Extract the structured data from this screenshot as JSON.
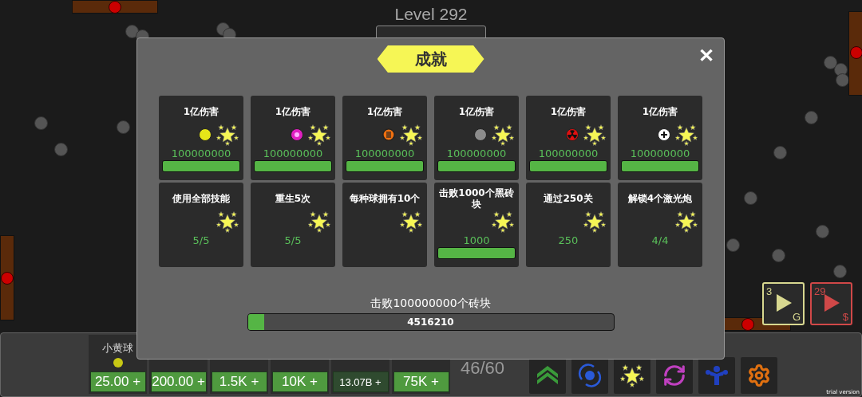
{
  "level_label": "Level 292",
  "dialog": {
    "title": "成就",
    "close": "✕",
    "achievements": [
      {
        "title": "1亿伤害",
        "ball": {
          "kind": "plain",
          "color": "#e6e619"
        },
        "value": "100000000",
        "level": 1
      },
      {
        "title": "1亿伤害",
        "ball": {
          "kind": "glow",
          "color": "#e020c0"
        },
        "value": "100000000",
        "level": 1
      },
      {
        "title": "1亿伤害",
        "ball": {
          "kind": "striped",
          "color": "#f07010"
        },
        "value": "100000000",
        "level": 1
      },
      {
        "title": "1亿伤害",
        "ball": {
          "kind": "plain",
          "color": "#8c8c8c"
        },
        "value": "100000000",
        "level": 1
      },
      {
        "title": "1亿伤害",
        "ball": {
          "kind": "radiation",
          "color": "#e01010"
        },
        "value": "100000000",
        "level": 1
      },
      {
        "title": "1亿伤害",
        "ball": {
          "kind": "plus",
          "color": "#ffffff"
        },
        "value": "100000000",
        "level": 1
      },
      {
        "title": "使用全部技能",
        "value": "5/5"
      },
      {
        "title": "重生5次",
        "value": "5/5"
      },
      {
        "title": "每种球拥有10个"
      },
      {
        "title": "击败1000个黑砖块",
        "value": "1000",
        "level": 1
      },
      {
        "title": "通过250关",
        "value": "250"
      },
      {
        "title": "解锁4个激光炮",
        "value": "4/4"
      }
    ],
    "goal": {
      "label": "击败100000000个砖块",
      "reading": "4516210",
      "level": 0.045
    }
  },
  "ball_slots": [
    {
      "name": "小黄球",
      "color": "#c8c814",
      "price": "25.00 +",
      "dim": false
    },
    {
      "price": "200.00 +",
      "dim": false
    },
    {
      "price": "1.5K +",
      "dim": false
    },
    {
      "price": "10K +",
      "dim": false
    },
    {
      "price": "13.07B +",
      "dim": true
    },
    {
      "price": "75K +",
      "dim": false
    }
  ],
  "ball_count": "46/60",
  "skills": [
    {
      "kind": "chevrons"
    },
    {
      "kind": "swirl"
    },
    {
      "kind": "stars"
    },
    {
      "kind": "refresh"
    },
    {
      "kind": "figure"
    },
    {
      "kind": "gear"
    }
  ],
  "speed_buttons": [
    {
      "count": "3",
      "unit": "G",
      "color": "#d8d890"
    },
    {
      "count": "29",
      "unit": "$",
      "color": "#d04848"
    }
  ],
  "footer_note": "trial version"
}
